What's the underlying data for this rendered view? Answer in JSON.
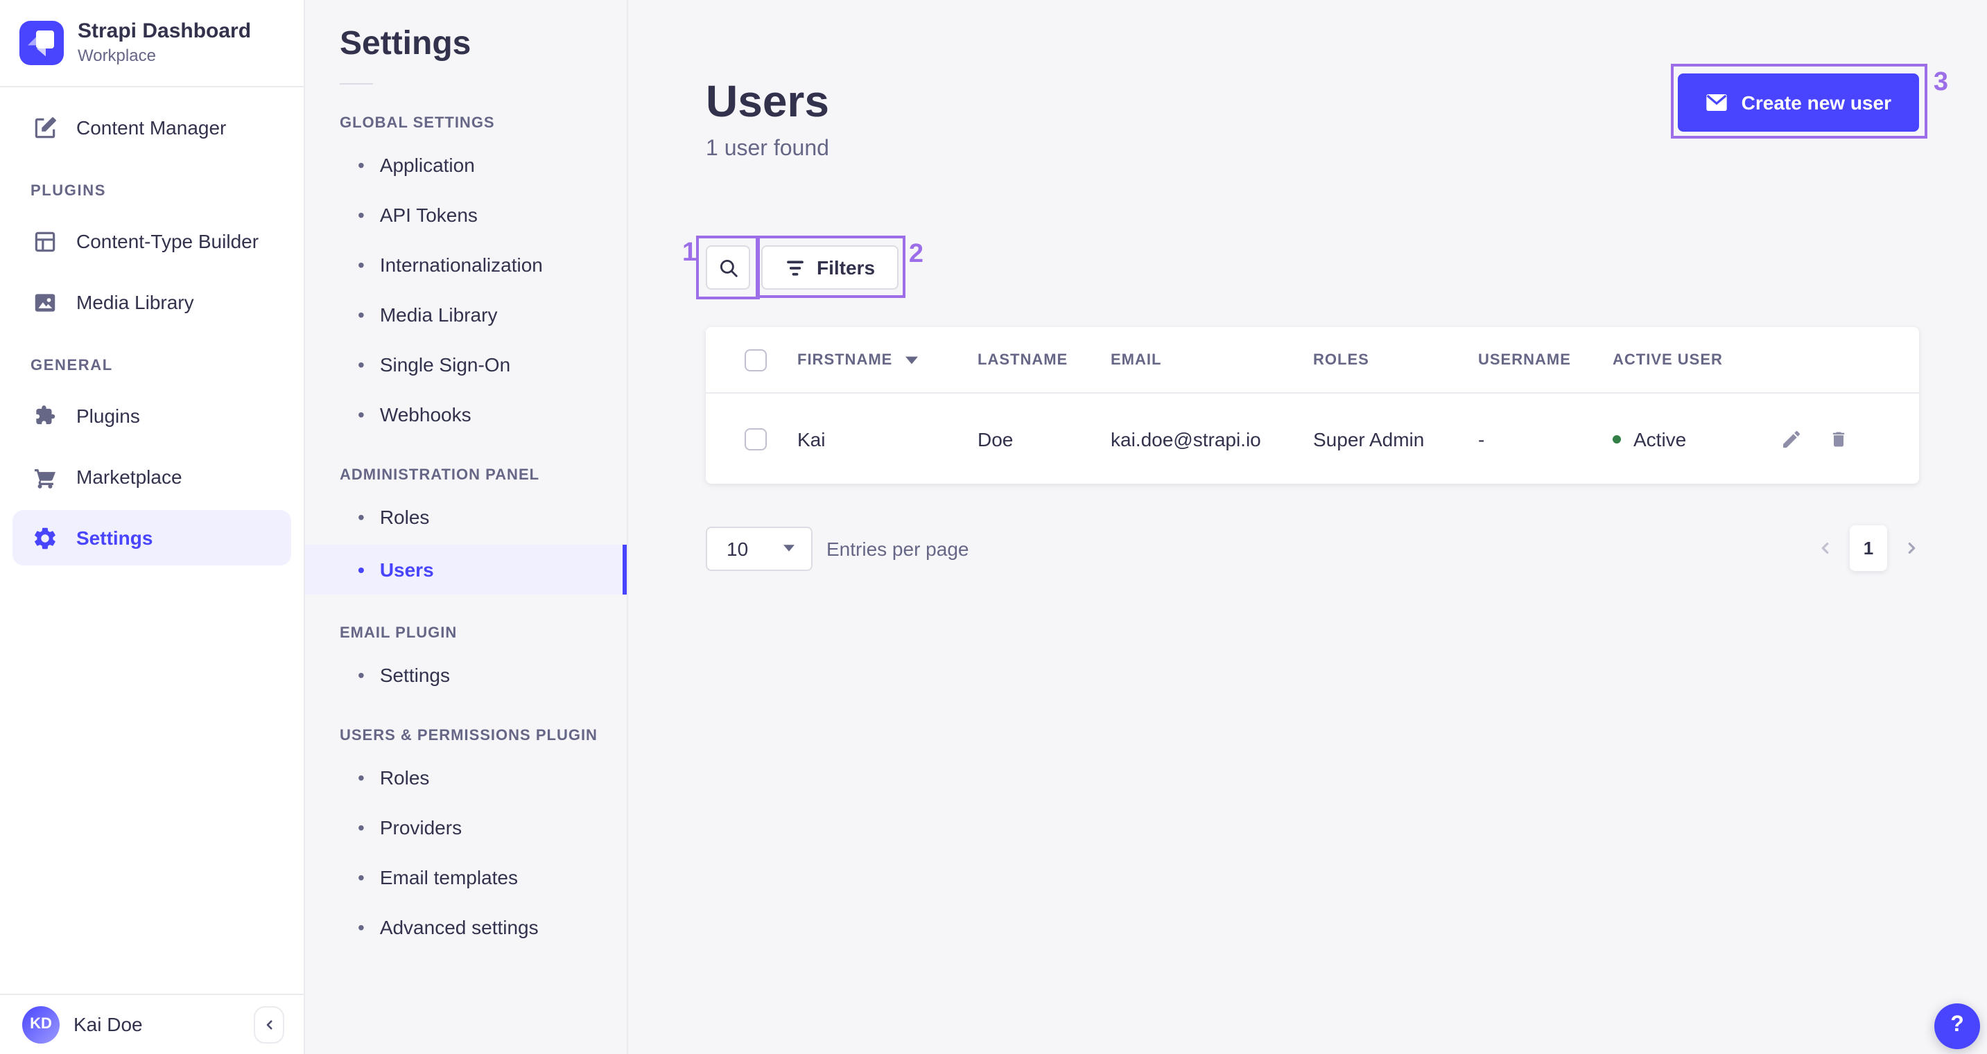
{
  "sidebar": {
    "app_name": "Strapi Dashboard",
    "workspace": "Workplace",
    "content_manager": {
      "label": "Content Manager"
    },
    "sections": [
      {
        "label": "PLUGINS",
        "items": [
          {
            "label": "Content-Type Builder"
          },
          {
            "label": "Media Library"
          }
        ]
      },
      {
        "label": "GENERAL",
        "items": [
          {
            "label": "Plugins"
          },
          {
            "label": "Marketplace"
          },
          {
            "label": "Settings"
          }
        ]
      }
    ],
    "user": {
      "initials": "KD",
      "name": "Kai Doe"
    }
  },
  "subnav": {
    "title": "Settings",
    "sections": [
      {
        "label": "GLOBAL SETTINGS",
        "items": [
          "Application",
          "API Tokens",
          "Internationalization",
          "Media Library",
          "Single Sign-On",
          "Webhooks"
        ]
      },
      {
        "label": "ADMINISTRATION PANEL",
        "items": [
          "Roles",
          "Users"
        ]
      },
      {
        "label": "EMAIL PLUGIN",
        "items": [
          "Settings"
        ]
      },
      {
        "label": "USERS & PERMISSIONS PLUGIN",
        "items": [
          "Roles",
          "Providers",
          "Email templates",
          "Advanced settings"
        ]
      }
    ],
    "active_item": "Users"
  },
  "main": {
    "title": "Users",
    "subtitle": "1 user found",
    "create_button_label": "Create new user",
    "filters_button_label": "Filters",
    "table": {
      "headers": {
        "firstname": "FIRSTNAME",
        "lastname": "LASTNAME",
        "email": "EMAIL",
        "roles": "ROLES",
        "username": "USERNAME",
        "active_user": "ACTIVE USER"
      },
      "rows": [
        {
          "firstname": "Kai",
          "lastname": "Doe",
          "email": "kai.doe@strapi.io",
          "roles": "Super Admin",
          "username": "-",
          "status": "Active"
        }
      ]
    },
    "pagination": {
      "page_size": "10",
      "entries_label": "Entries per page",
      "current_page": "1"
    }
  },
  "help": {
    "label": "?"
  },
  "annotations": {
    "box1_label": "1",
    "box2_label": "2",
    "box3_label": "3"
  },
  "colors": {
    "brand": "#4945FF",
    "brand_light_bg": "#F0F0FF",
    "annotation": "#9C6EE8",
    "success_dot": "#328048",
    "text_dark": "#32324D",
    "text_gray": "#666687"
  }
}
